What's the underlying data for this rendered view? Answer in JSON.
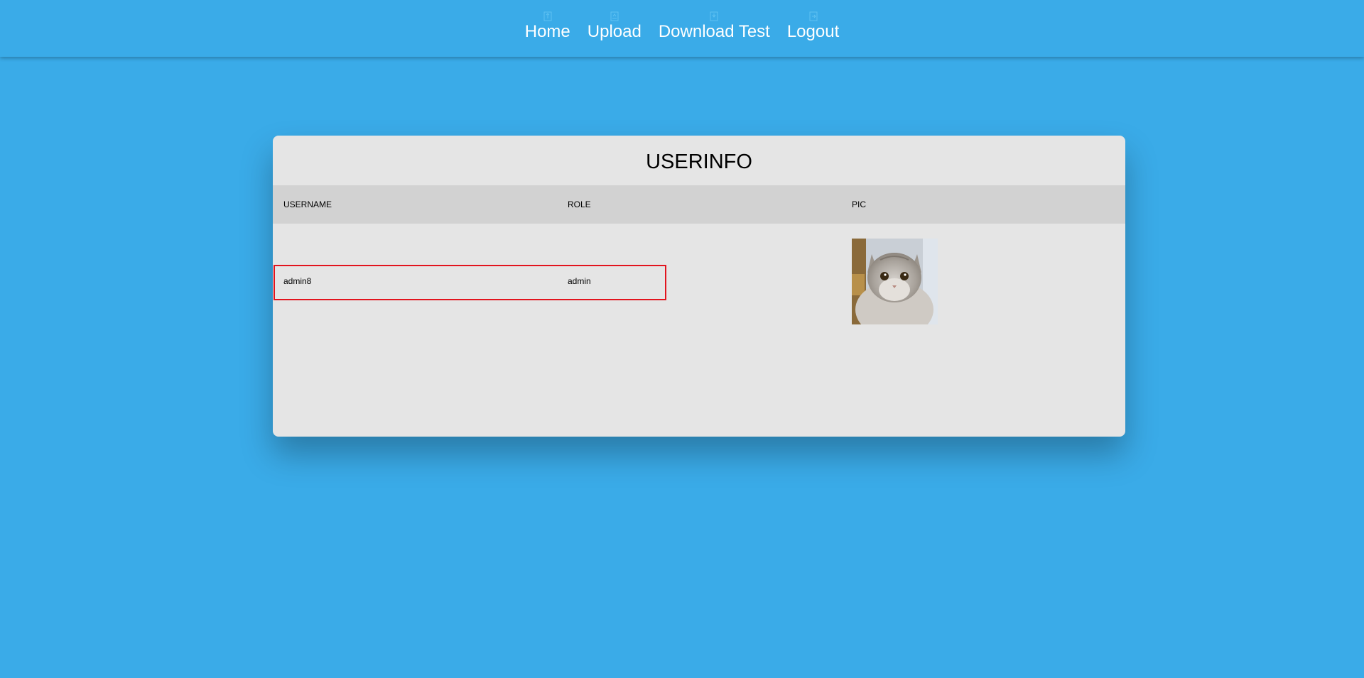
{
  "nav": {
    "items": [
      {
        "label": "Home",
        "icon": "home-icon"
      },
      {
        "label": "Upload",
        "icon": "upload-icon"
      },
      {
        "label": "Download Test",
        "icon": "download-icon"
      },
      {
        "label": "Logout",
        "icon": "logout-icon"
      }
    ]
  },
  "card": {
    "title": "USERINFO",
    "columns": [
      "USERNAME",
      "ROLE",
      "PIC"
    ],
    "rows": [
      {
        "username": "admin8",
        "role": "admin",
        "pic": "cat-avatar"
      }
    ]
  },
  "colors": {
    "background": "#3aabe8",
    "card": "#e5e5e5",
    "header_row": "#d2d2d2",
    "highlight": "#e2141e"
  }
}
